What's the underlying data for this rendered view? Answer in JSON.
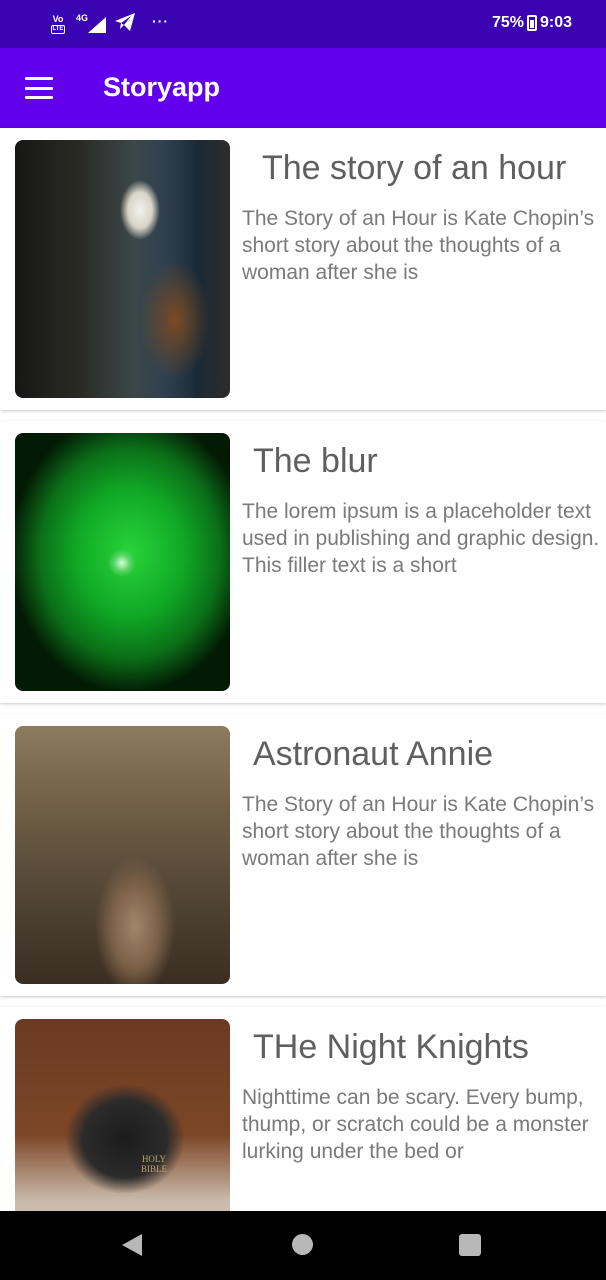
{
  "status_bar": {
    "volte": "Vo",
    "lte": "LTE",
    "network": "4G",
    "more": "···",
    "battery_percent": "75%",
    "time": "9:03"
  },
  "app_bar": {
    "title": "Storyapp",
    "menu_icon": "hamburger-menu-icon"
  },
  "stories": [
    {
      "title": "The story of an hour",
      "description": " The Story of an Hour is Kate Chopin’s short story about the thoughts of a woman after she is",
      "image": "coffee-pour-over"
    },
    {
      "title": "The blur",
      "description": "The lorem ipsum is a placeholder text used in publishing and graphic design. This filler text is a short",
      "image": "green-leaf-water-drop"
    },
    {
      "title": "Astronaut Annie",
      "description": "The Story of an Hour is Kate Chopin’s short story about the thoughts of a woman after she is",
      "image": "fawn-in-forest"
    },
    {
      "title": "THe Night Knights",
      "description": "Nighttime can be scary. Every bump, thump, or scratch could be a monster lurking under the bed or",
      "image": "child-reading-bible"
    }
  ],
  "nav_bar": {
    "back_icon": "back-triangle-icon",
    "home_icon": "home-circle-icon",
    "recents_icon": "recents-square-icon"
  },
  "colors": {
    "status_bar": "#3a04b3",
    "app_bar": "#6200ee",
    "title_text": "#5f5f5f",
    "body_text": "#7a7a7a"
  }
}
